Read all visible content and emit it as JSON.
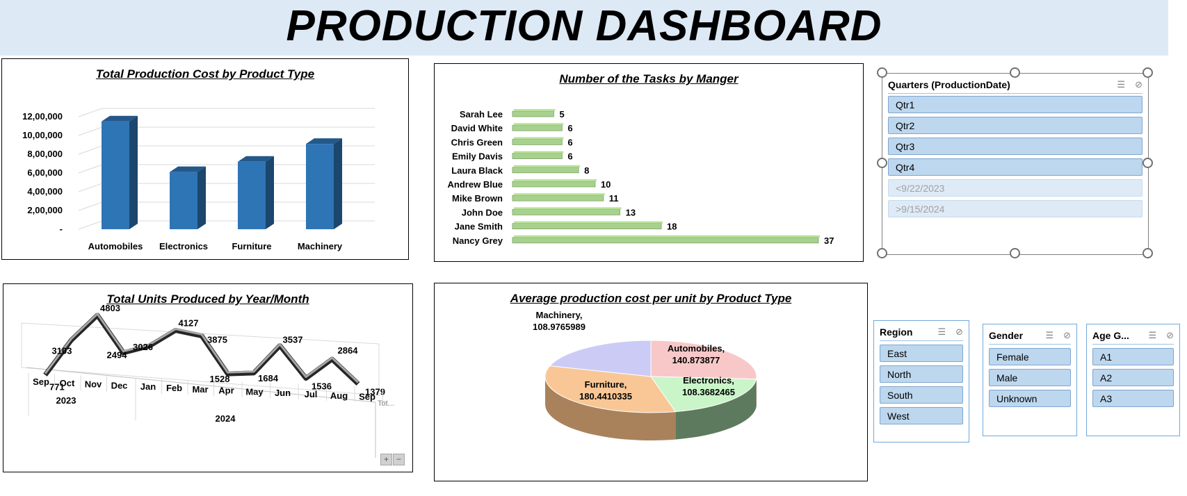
{
  "dashboard": {
    "title": "PRODUCTION DASHBOARD"
  },
  "chart_data": [
    {
      "type": "bar",
      "title": "Total Production Cost by Product Type",
      "categories": [
        "Automobiles",
        "Electronics",
        "Furniture",
        "Machinery"
      ],
      "values": [
        1150000,
        610000,
        720000,
        910000
      ],
      "ylim": [
        0,
        1200000
      ],
      "yticks": [
        0,
        200000,
        400000,
        600000,
        800000,
        1000000,
        1200000
      ],
      "ytick_labels": [
        "-",
        "2,00,000",
        "4,00,000",
        "6,00,000",
        "8,00,000",
        "10,00,000",
        "12,00,000"
      ],
      "color": "#2e75b6",
      "grid": true
    },
    {
      "type": "bar",
      "orientation": "horizontal",
      "title": "Number of the Tasks by Manger",
      "categories": [
        "Sarah Lee",
        "David White",
        "Chris Green",
        "Emily Davis",
        "Laura Black",
        "Andrew Blue",
        "Mike Brown",
        "John Doe",
        "Jane Smith",
        "Nancy Grey"
      ],
      "values": [
        5,
        6,
        6,
        6,
        8,
        10,
        11,
        13,
        18,
        37
      ],
      "xlim": [
        0,
        37
      ],
      "color": "#a9d18e",
      "data_labels": true
    },
    {
      "type": "line",
      "title": "Total Units Produced by Year/Month",
      "x": [
        "Sep",
        "Oct",
        "Nov",
        "Dec",
        "Jan",
        "Feb",
        "Mar",
        "Apr",
        "May",
        "Jun",
        "Jul",
        "Aug",
        "Sep"
      ],
      "groups": [
        {
          "label": "2023",
          "start": 0,
          "end": 3
        },
        {
          "label": "2024",
          "start": 4,
          "end": 12
        }
      ],
      "values": [
        771,
        3103,
        4803,
        2494,
        3026,
        4127,
        3875,
        1528,
        1684,
        3537,
        1536,
        2864,
        1379
      ],
      "ylim": [
        0,
        5000
      ],
      "series_label": "Tot...",
      "color": "#595959",
      "data_labels": true
    },
    {
      "type": "pie",
      "title": "Average production cost per unit by Product Type",
      "slices": [
        {
          "name": "Automobiles",
          "value": 140.873877,
          "label": "Automobiles,",
          "value_label": "140.873877",
          "color": "#f8c8c8",
          "side": "#c48a8a"
        },
        {
          "name": "Electronics",
          "value": 108.3682465,
          "label": "Electronics,",
          "value_label": "108.3682465",
          "color": "#c9f5c9",
          "side": "#5e7a5e"
        },
        {
          "name": "Furniture",
          "value": 180.4410335,
          "label": "Furniture,",
          "value_label": "180.4410335",
          "color": "#f9c796",
          "side": "#a9825c"
        },
        {
          "name": "Machinery",
          "value": 108.9765989,
          "label": "Machinery,",
          "value_label": "108.9765989",
          "color": "#cbcbf6",
          "side": "#8c8cb8"
        }
      ]
    }
  ],
  "zoom": {
    "plus": "+",
    "minus": "−"
  },
  "slicers": {
    "quarters": {
      "title": "Quarters (ProductionDate)",
      "items": [
        "Qtr1",
        "Qtr2",
        "Qtr3",
        "Qtr4",
        "<9/22/2023",
        ">9/15/2024"
      ]
    },
    "region": {
      "title": "Region",
      "items": [
        "East",
        "North",
        "South",
        "West"
      ]
    },
    "gender": {
      "title": "Gender",
      "items": [
        "Female",
        "Male",
        "Unknown"
      ]
    },
    "age_group": {
      "title": "Age G...",
      "items": [
        "A1",
        "A2",
        "A3"
      ]
    }
  },
  "icons": {
    "multiselect": "multi-select-icon",
    "clear_filter": "clear-filter-icon",
    "multiselect_glyph": "☰",
    "clear_glyph": "⊘"
  }
}
